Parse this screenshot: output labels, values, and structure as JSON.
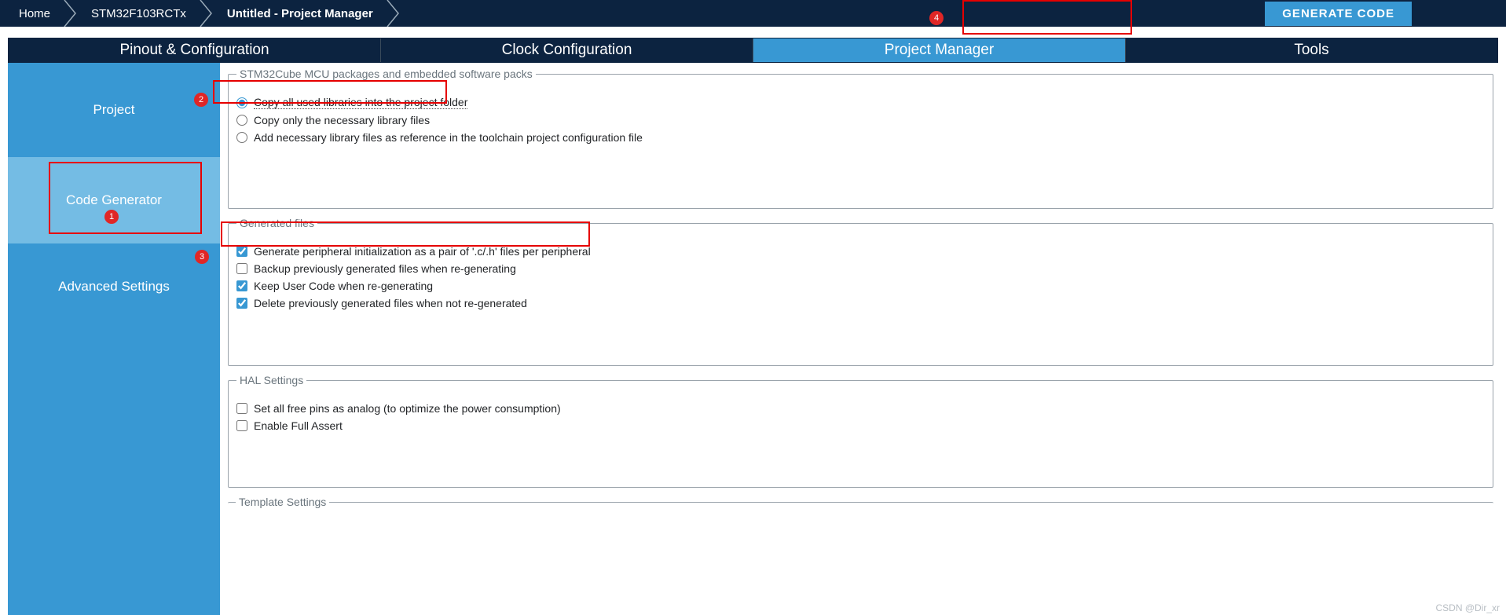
{
  "breadcrumb": {
    "home": "Home",
    "chip": "STM32F103RCTx",
    "project": "Untitled - Project Manager"
  },
  "generate_btn": "GENERATE CODE",
  "tabs": {
    "pinout": "Pinout & Configuration",
    "clock": "Clock Configuration",
    "pm": "Project Manager",
    "tools": "Tools"
  },
  "sidebar": {
    "project": "Project",
    "codegen": "Code Generator",
    "adv": "Advanced Settings"
  },
  "groups": {
    "mcu": {
      "legend": "STM32Cube MCU packages and embedded software packs",
      "opt1": "Copy all used libraries into the project folder",
      "opt2": "Copy only the necessary library files",
      "opt3": "Add necessary library files as reference in the toolchain project configuration file"
    },
    "gen": {
      "legend": "Generated files",
      "c1": "Generate peripheral initialization as a pair of '.c/.h' files per peripheral",
      "c2": "Backup previously generated files when re-generating",
      "c3": "Keep User Code when re-generating",
      "c4": "Delete previously generated files when not re-generated"
    },
    "hal": {
      "legend": "HAL Settings",
      "c1": "Set all free pins as analog (to optimize the power consumption)",
      "c2": "Enable Full Assert"
    },
    "tpl": {
      "legend": "Template Settings"
    }
  },
  "annotations": {
    "a1": "1",
    "a2": "2",
    "a3": "3",
    "a4": "4"
  },
  "watermark": "CSDN @Dir_xr"
}
